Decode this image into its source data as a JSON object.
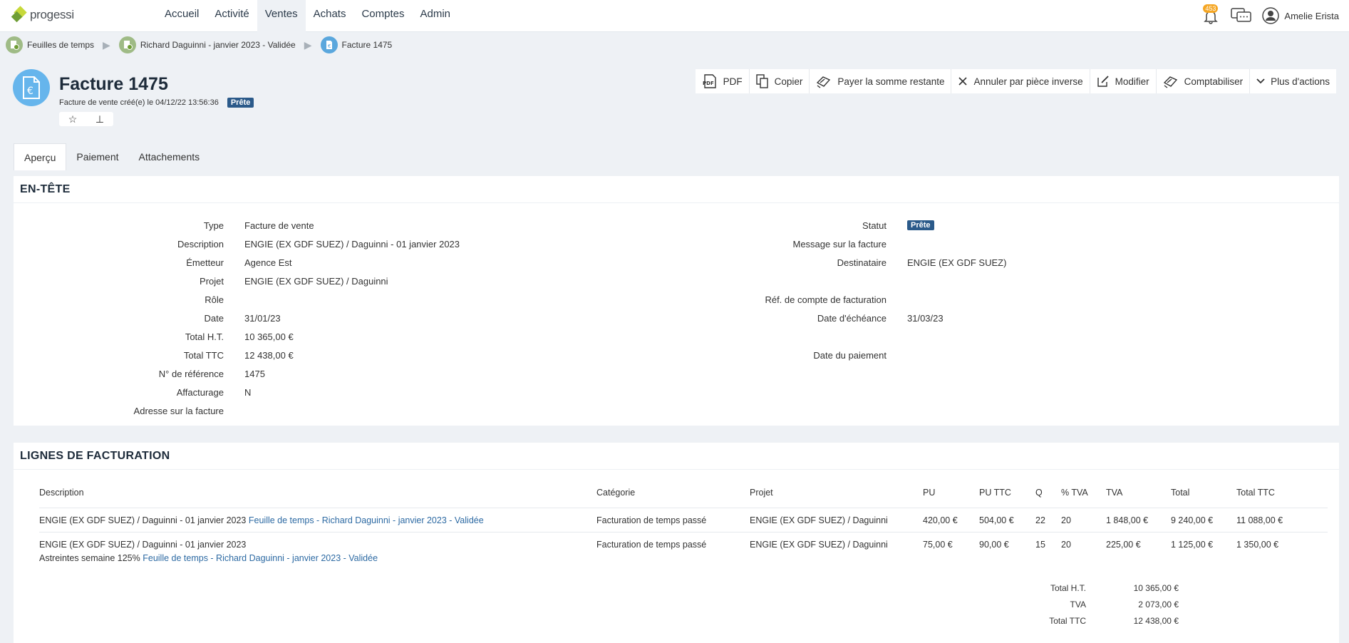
{
  "app": {
    "logo_text": "progessi"
  },
  "nav": {
    "items": [
      {
        "label": "Accueil"
      },
      {
        "label": "Activité"
      },
      {
        "label": "Ventes"
      },
      {
        "label": "Achats"
      },
      {
        "label": "Comptes"
      },
      {
        "label": "Admin"
      }
    ],
    "active": "Ventes"
  },
  "header_right": {
    "notifications_count": "453",
    "user_name": "Amelie Erista"
  },
  "breadcrumb": [
    {
      "label": "Feuilles de temps"
    },
    {
      "label": "Richard Daguinni - janvier 2023 - Validée"
    },
    {
      "label": "Facture 1475"
    }
  ],
  "page": {
    "title": "Facture 1475",
    "subtitle": "Facture de vente créé(e) le 04/12/22 13:56:36",
    "status_tag": "Prête"
  },
  "actions": [
    {
      "label": "PDF",
      "icon": "pdf-icon"
    },
    {
      "label": "Copier",
      "icon": "copy-icon"
    },
    {
      "label": "Payer la somme restante",
      "icon": "pay-icon"
    },
    {
      "label": "Annuler par pièce inverse",
      "icon": "close-icon"
    },
    {
      "label": "Modifier",
      "icon": "edit-icon"
    },
    {
      "label": "Comptabiliser",
      "icon": "accounting-icon"
    },
    {
      "label": "Plus d'actions",
      "icon": "chevron-down-icon"
    }
  ],
  "tabs": [
    {
      "label": "Aperçu"
    },
    {
      "label": "Paiement"
    },
    {
      "label": "Attachements"
    }
  ],
  "header_section": {
    "title": "EN-TÊTE",
    "left": [
      {
        "label": "Type",
        "value": "Facture de vente"
      },
      {
        "label": "Description",
        "value": "ENGIE (EX GDF SUEZ) / Daguinni - 01 janvier 2023"
      },
      {
        "label": "Émetteur",
        "value": "Agence Est",
        "link": true
      },
      {
        "label": "Projet",
        "value": "ENGIE (EX GDF SUEZ) / Daguinni",
        "link": true
      },
      {
        "label": "Rôle",
        "value": ""
      },
      {
        "label": "Date",
        "value": "31/01/23"
      },
      {
        "label": "Total H.T.",
        "value": "10 365,00 €"
      },
      {
        "label": "Total TTC",
        "value": "12 438,00 €"
      },
      {
        "label": "N° de référence",
        "value": "1475"
      },
      {
        "label": "Affacturage",
        "value": "N"
      },
      {
        "label": "Adresse sur la facture",
        "value": ""
      }
    ],
    "right": {
      "statut_label": "Statut",
      "statut_value": "Prête",
      "message_label": "Message sur la facture",
      "destinataire_label": "Destinataire",
      "destinataire_value": "ENGIE (EX GDF SUEZ)",
      "ref_compte_label": "Réf. de compte de facturation",
      "echeance_label": "Date d'échéance",
      "echeance_value": "31/03/23",
      "paiement_label": "Date du paiement"
    }
  },
  "lines_section": {
    "title": "LIGNES DE FACTURATION",
    "columns": {
      "description": "Description",
      "categorie": "Catégorie",
      "projet": "Projet",
      "pu": "PU",
      "pu_ttc": "PU TTC",
      "q": "Q",
      "tva_pct": "% TVA",
      "tva": "TVA",
      "total": "Total",
      "total_ttc": "Total TTC"
    },
    "rows": [
      {
        "description": "ENGIE (EX GDF SUEZ) / Daguinni - 01 janvier 2023",
        "description_extra": "",
        "link": "Feuille de temps - Richard Daguinni - janvier 2023 - Validée",
        "categorie": "Facturation de temps passé",
        "projet": "ENGIE (EX GDF SUEZ) / Daguinni",
        "pu": "420,00 €",
        "pu_ttc": "504,00 €",
        "q": "22",
        "tva_pct": "20",
        "tva": "1 848,00 €",
        "total": "9 240,00 €",
        "total_ttc": "11 088,00 €"
      },
      {
        "description": "ENGIE (EX GDF SUEZ) / Daguinni - 01 janvier 2023",
        "description_extra": "Astreintes semaine 125%",
        "link": "Feuille de temps - Richard Daguinni - janvier 2023 - Validée",
        "categorie": "Facturation de temps passé",
        "projet": "ENGIE (EX GDF SUEZ) / Daguinni",
        "pu": "75,00 €",
        "pu_ttc": "90,00 €",
        "q": "15",
        "tva_pct": "20",
        "tva": "225,00 €",
        "total": "1 125,00 €",
        "total_ttc": "1 350,00 €"
      }
    ],
    "totals": [
      {
        "label": "Total H.T.",
        "value": "10 365,00 €"
      },
      {
        "label": "TVA",
        "value": "2 073,00 €"
      },
      {
        "label": "Total TTC",
        "value": "12 438,00 €"
      }
    ]
  },
  "colors": {
    "accent": "#2d6aa3",
    "tag": "#2b5a8a",
    "page_icon": "#66b5ec",
    "badge": "#f5a623"
  }
}
